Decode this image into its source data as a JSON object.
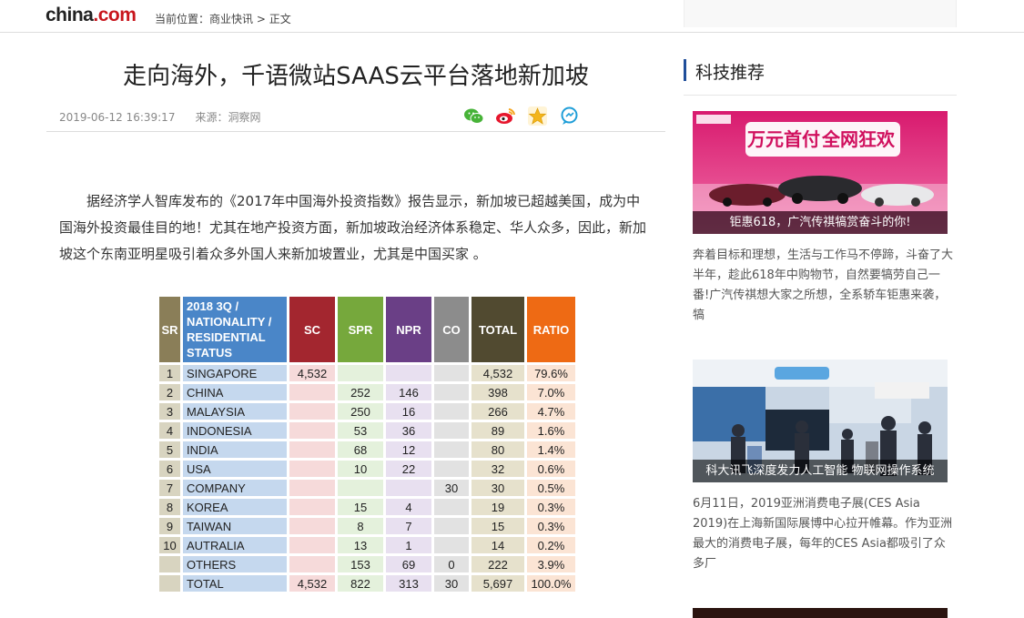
{
  "header": {
    "logo_main": "china",
    "logo_suffix": ".com",
    "breadcrumb_label": "当前位置：",
    "breadcrumb_section": "商业快讯",
    "breadcrumb_separator": " > ",
    "breadcrumb_current": "正文"
  },
  "article": {
    "title": "走向海外，千语微站SAAS云平台落地新加坡",
    "date": "2019-06-12 16:39:17",
    "source": "来源：洞察网",
    "share_icons": [
      "wechat-icon",
      "weibo-icon",
      "favorite-star-icon",
      "comment-icon"
    ],
    "paragraph": "据经济学人智库发布的《2017年中国海外投资指数》报告显示，新加坡已超越美国，成为中国海外投资最佳目的地！尤其在地产投资方面，新加坡政治经济体系稳定、华人众多，因此，新加坡这个东南亚明星吸引着众多外国人来新加坡置业，尤其是中国买家 。"
  },
  "table": {
    "headers": [
      {
        "label": "SR",
        "color": "#8a7e58"
      },
      {
        "label": "2018 3Q / NATIONALITY / RESIDENTIAL STATUS",
        "color": "#4a86c8"
      },
      {
        "label": "SC",
        "color": "#a3262f"
      },
      {
        "label": "SPR",
        "color": "#76a83c"
      },
      {
        "label": "NPR",
        "color": "#6a3f86"
      },
      {
        "label": "CO",
        "color": "#8c8c8c"
      },
      {
        "label": "TOTAL",
        "color": "#514a30"
      },
      {
        "label": "RATIO",
        "color": "#ee6a14"
      }
    ],
    "rows": [
      {
        "sr": "1",
        "nat": "SINGAPORE",
        "sc": "4,532",
        "spr": "",
        "npr": "",
        "co": "",
        "total": "4,532",
        "ratio": "79.6%"
      },
      {
        "sr": "2",
        "nat": "CHINA",
        "sc": "",
        "spr": "252",
        "npr": "146",
        "co": "",
        "total": "398",
        "ratio": "7.0%"
      },
      {
        "sr": "3",
        "nat": "MALAYSIA",
        "sc": "",
        "spr": "250",
        "npr": "16",
        "co": "",
        "total": "266",
        "ratio": "4.7%"
      },
      {
        "sr": "4",
        "nat": "INDONESIA",
        "sc": "",
        "spr": "53",
        "npr": "36",
        "co": "",
        "total": "89",
        "ratio": "1.6%"
      },
      {
        "sr": "5",
        "nat": "INDIA",
        "sc": "",
        "spr": "68",
        "npr": "12",
        "co": "",
        "total": "80",
        "ratio": "1.4%"
      },
      {
        "sr": "6",
        "nat": "USA",
        "sc": "",
        "spr": "10",
        "npr": "22",
        "co": "",
        "total": "32",
        "ratio": "0.6%"
      },
      {
        "sr": "7",
        "nat": "COMPANY",
        "sc": "",
        "spr": "",
        "npr": "",
        "co": "30",
        "total": "30",
        "ratio": "0.5%"
      },
      {
        "sr": "8",
        "nat": "KOREA",
        "sc": "",
        "spr": "15",
        "npr": "4",
        "co": "",
        "total": "19",
        "ratio": "0.3%"
      },
      {
        "sr": "9",
        "nat": "TAIWAN",
        "sc": "",
        "spr": "8",
        "npr": "7",
        "co": "",
        "total": "15",
        "ratio": "0.3%"
      },
      {
        "sr": "10",
        "nat": "AUTRALIA",
        "sc": "",
        "spr": "13",
        "npr": "1",
        "co": "",
        "total": "14",
        "ratio": "0.2%"
      },
      {
        "sr": "",
        "nat": "OTHERS",
        "sc": "",
        "spr": "153",
        "npr": "69",
        "co": "0",
        "total": "222",
        "ratio": "3.9%"
      },
      {
        "sr": "",
        "nat": "TOTAL",
        "sc": "4,532",
        "spr": "822",
        "npr": "313",
        "co": "30",
        "total": "5,697",
        "ratio": "100.0%"
      }
    ]
  },
  "sidebar": {
    "heading": "科技推荐",
    "accent_color": "#1f4e9a",
    "cards": [
      {
        "banner_line1": "万元首付",
        "banner_line2": "全网狂欢",
        "caption": "钜惠618，广汽传祺犒赏奋斗的你!",
        "description": "奔着目标和理想，生活与工作马不停蹄，斗奋了大半年，趁此618年中购物节，自然要犒劳自己一番!广汽传祺想大家之所想，全系轿车钜惠来袭，犒"
      },
      {
        "caption": "科大讯飞深度发力人工智能 物联网操作系统",
        "description": "6月11日，2019亚洲消费电子展(CES Asia 2019)在上海新国际展博中心拉开帷幕。作为亚洲最大的消费电子展，每年的CES Asia都吸引了众多厂"
      }
    ]
  }
}
